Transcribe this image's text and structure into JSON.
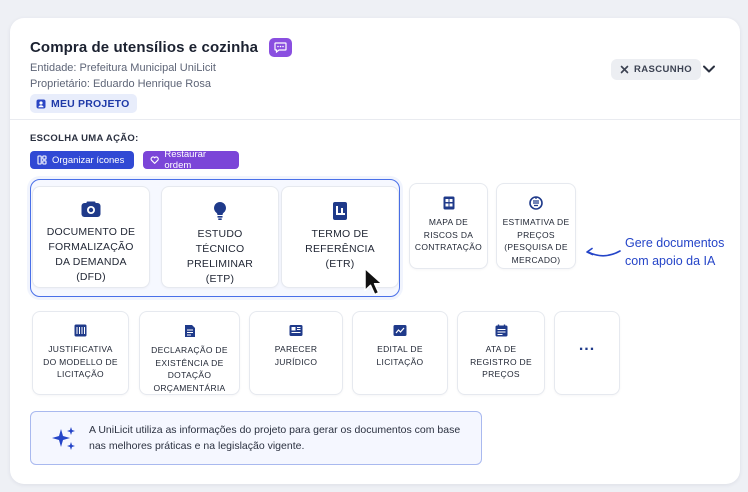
{
  "header": {
    "title": "Compra de utensílios e cozinha",
    "entity": "Entidade: Prefeitura Municipal UniLicit",
    "owner": "Proprietário: Eduardo Henrique Rosa",
    "project_button": "MEU PROJETO",
    "status": "RASCUNHO"
  },
  "actions": {
    "label": "ESCOLHA UMA AÇÃO:",
    "organize": "Organizar ícones",
    "restore": "Restaurar ordem"
  },
  "featured": [
    {
      "label": "DOCUMENTO DE\nFORMALIZAÇÃO\nDA DEMANDA\n(DFD)",
      "icon": "document-id-icon"
    },
    {
      "label": "ESTUDO\nTÉCNICO\nPRELIMINAR\n(ETP)",
      "icon": "lightbulb-icon"
    },
    {
      "label": "TERMO DE\nREFERÊNCIA\n(ETR)",
      "icon": "reference-doc-icon"
    }
  ],
  "side_docs": [
    {
      "label": "MAPA DE\nRISCOS DA\nCONTRATAÇÃO",
      "icon": "risk-map-icon"
    },
    {
      "label": "ESTIMATIVA DE\nPREÇOS\n(PESQUISA DE\nMERCADO)",
      "icon": "price-estimate-icon"
    }
  ],
  "row_docs": [
    {
      "label": "JUSTIFICATIVA\nDO MODELLO DE\nLICITAÇÃO",
      "icon": "justification-icon"
    },
    {
      "label": "DECLARAÇÃO DE\nEXISTÊNCIA DE\nDOTAÇÃO\nORÇAMENTÁRIA",
      "icon": "declaration-icon"
    },
    {
      "label": "PARECER\nJURÍDICO",
      "icon": "legal-opinion-icon"
    },
    {
      "label": "EDITAL DE\nLICITAÇÃO",
      "icon": "bid-notice-icon"
    },
    {
      "label": "ATA DE\nREGISTRO DE\nPREÇOS",
      "icon": "price-registry-icon"
    },
    {
      "label": "...",
      "icon": "more-icon"
    }
  ],
  "hint": "Gere documentos\ncom apoio da IA",
  "info": "A UniLicit utiliza as informações do projeto para gerar os documentos com base nas melhores práticas e na legislação vigente.",
  "colors": {
    "primary": "#3049d4",
    "purple": "#7b45d8",
    "accent_blue": "#2545c8",
    "icon_navy": "#1f3a8a"
  }
}
